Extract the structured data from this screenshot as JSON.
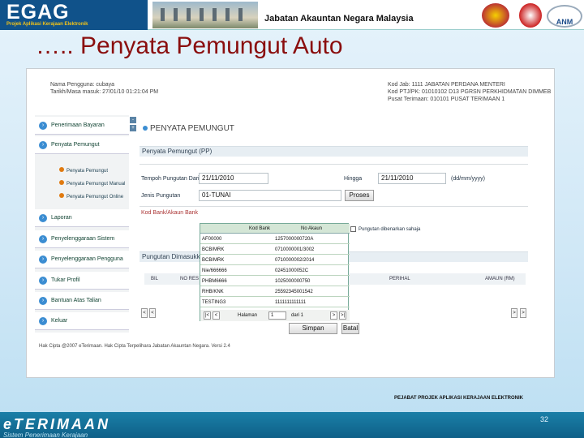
{
  "header": {
    "logo_text": "EGAG",
    "logo_subtitle": "Projek Aplikasi Kerajaan Elektronik",
    "agency": "Jabatan Akauntan Negara Malaysia",
    "anm_logo": "ANM"
  },
  "slide_title": "….. Penyata Pemungut Auto",
  "user_info": {
    "left": [
      "Nama Pengguna: cubaya",
      "Tarikh/Masa masuk: 27/01/10 01:21:04 PM"
    ],
    "right": [
      "Kod Jab: 1111 JABATAN PERDANA MENTERI",
      "Kod PTJ/PK: 01010102 D13 PGRSN PERKHIDMATAN DIMMEB",
      "Pusat Terimaan: 010101 PUSAT TERIMAAN 1"
    ]
  },
  "nav": {
    "items": [
      "Penerimaan Bayaran",
      "Penyata Pemungut",
      "Laporan",
      "Penyelenggaraan Sistem",
      "Penyelenggaraan Pengguna",
      "Tukar Profil",
      "Bantuan Atas Talian",
      "Keluar"
    ],
    "sub_items": [
      "Penyata Pemungut",
      "Penyata Pemungut Manual",
      "Penyata Pemungut Online"
    ],
    "toggle_minus": "-",
    "toggle_plus": "+"
  },
  "form": {
    "section_title": "PENYATA PEMUNGUT",
    "bar_title": "Penyata Pemungut (PP)",
    "label_tempoh": "Tempoh Pungutan Dari",
    "value_dari": "21/11/2010",
    "label_hingga": "Hingga",
    "value_hingga": "21/11/2010",
    "date_format": "(dd/mm/yyyy)",
    "label_jenis": "Jenis Pungutan",
    "value_jenis": "01-TUNAI",
    "proses_button": "Proses",
    "label_kod": "Kod Bank/Akaun Bank",
    "checkbox_label": "Pungutan dibenarkan sahaja",
    "bar2_title": "Pungutan Dimasukk",
    "table_headers": [
      "BIL",
      "NO RES",
      "PERIHAL",
      "AMAUN (RM)"
    ],
    "simpan_button": "Simpan",
    "batal_button": "Batal"
  },
  "popup": {
    "headers": [
      "Kod Bank",
      "No Akaun"
    ],
    "rows": [
      [
        "AF00000",
        "1257000000720A"
      ],
      [
        "BCB/MRK",
        "0710000001/3002"
      ],
      [
        "BCB/MRK",
        "0710000002/2014"
      ],
      [
        "Nie/666666",
        "02451000052C"
      ],
      [
        "PHBM6666",
        "1025000000750"
      ],
      [
        "RHB/KNK",
        "25592345001542"
      ],
      [
        "TESTING3",
        "1111111111111"
      ]
    ],
    "pager": {
      "first": "|<",
      "prev": "<",
      "label": "Halaman",
      "page": "1",
      "of": "dari 1",
      "next": ">",
      "last": ">|"
    }
  },
  "footer": {
    "copyright": "Hak Cipta @2007 eTerimaan. Hak Cipta Terpelihara Jabatan Akauntan Negara. Versi 2.4",
    "org": "PEJABAT PROJEK APLIKASI KERAJAAN ELEKTRONIK",
    "brand": "eTERIMAAN",
    "brand_sub": "Sistem Penerimaan Kerajaan",
    "page_number": "32"
  },
  "scroll": {
    "left": "<",
    "right": ">"
  },
  "colors": {
    "title": "#8a0e0e",
    "logo_bg": "#10528a",
    "accent_blue": "#3b8dd2",
    "footer_bar": "#1a7fa8"
  }
}
